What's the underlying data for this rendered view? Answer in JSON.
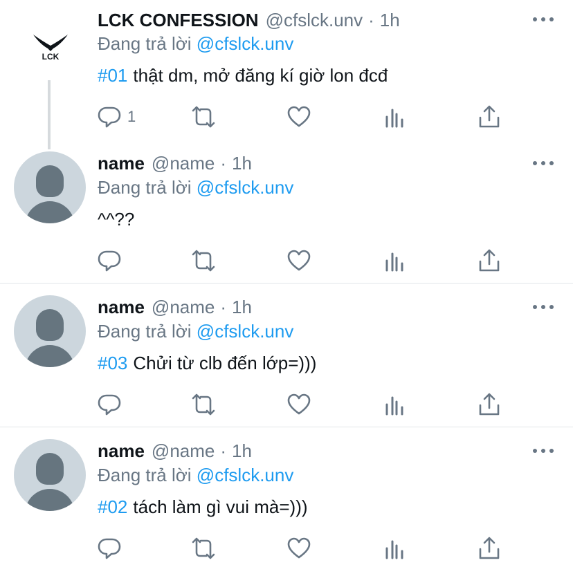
{
  "tweets": [
    {
      "author_name": "LCK CONFESSION",
      "author_handle": "@cfslck.unv",
      "time": "1h",
      "reply_prefix": "Đang trả lời",
      "reply_to": "@cfslck.unv",
      "hashtag": "#01",
      "text": "thật dm, mở đăng kí giờ lon đcđ",
      "reply_count": "1",
      "avatar": "lck-logo",
      "logo_text": "LCK"
    },
    {
      "author_name": "name",
      "author_handle": "@name",
      "time": "1h",
      "reply_prefix": "Đang trả lời",
      "reply_to": "@cfslck.unv",
      "hashtag": "",
      "text": "^^??",
      "reply_count": "",
      "avatar": "default-avatar"
    },
    {
      "author_name": "name",
      "author_handle": "@name",
      "time": "1h",
      "reply_prefix": "Đang trả lời",
      "reply_to": "@cfslck.unv",
      "hashtag": "#03",
      "text": "Chửi từ clb đến lớp=)))",
      "reply_count": "",
      "avatar": "default-avatar"
    },
    {
      "author_name": "name",
      "author_handle": "@name",
      "time": "1h",
      "reply_prefix": "Đang trả lời",
      "reply_to": "@cfslck.unv",
      "hashtag": "#02",
      "text": "tách làm gì vui mà=)))",
      "reply_count": "",
      "avatar": "default-avatar"
    }
  ],
  "separator": "·",
  "icons": [
    "more-icon",
    "reply-icon",
    "retweet-icon",
    "like-icon",
    "analytics-icon",
    "share-icon"
  ],
  "colors": {
    "link": "#1d9bf0",
    "secondary": "#687684",
    "avatar_bg": "#ccd6dd",
    "avatar_fg": "#66757f"
  }
}
